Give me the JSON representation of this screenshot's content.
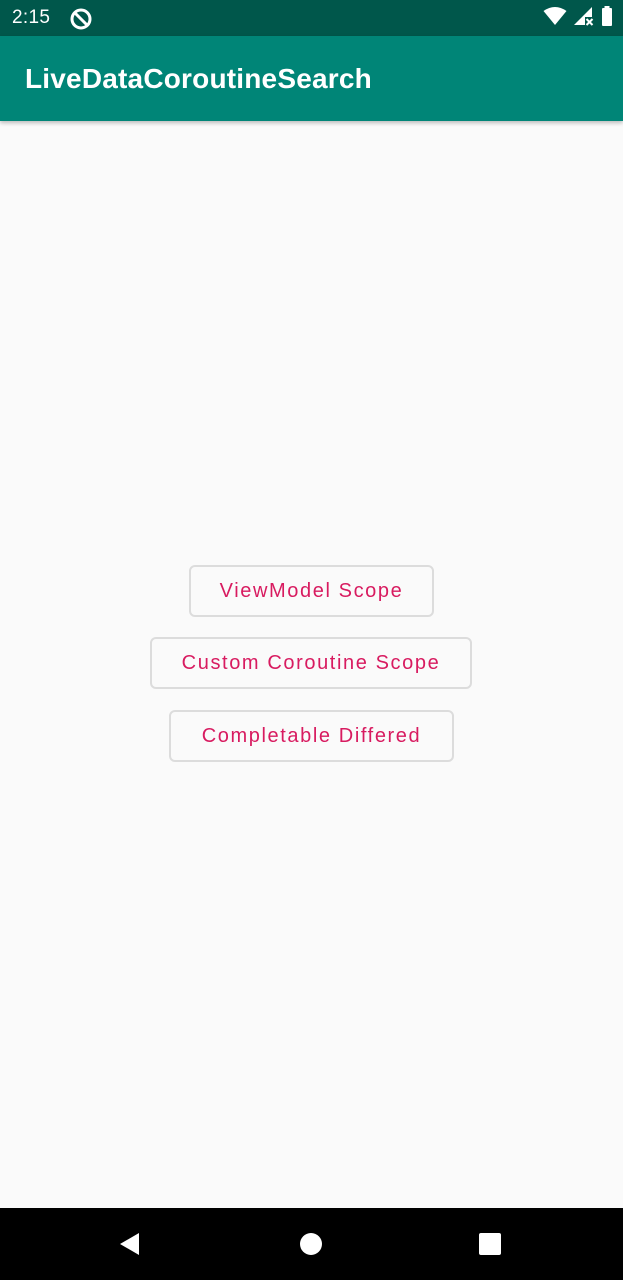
{
  "status_bar": {
    "time": "2:15",
    "icons": [
      "notification-icon",
      "wifi-icon",
      "signal-icon",
      "battery-icon"
    ],
    "color": "#00574b"
  },
  "app_bar": {
    "title": "LiveDataCoroutineSearch",
    "color": "#008577"
  },
  "buttons": {
    "viewmodel_scope": "ViewModel Scope",
    "custom_coroutine_scope": "Custom Coroutine Scope",
    "completable_differed": "Completable Differed",
    "text_color": "#d81b60"
  },
  "nav_bar": {
    "icons": [
      "back-icon",
      "home-icon",
      "recents-icon"
    ]
  }
}
